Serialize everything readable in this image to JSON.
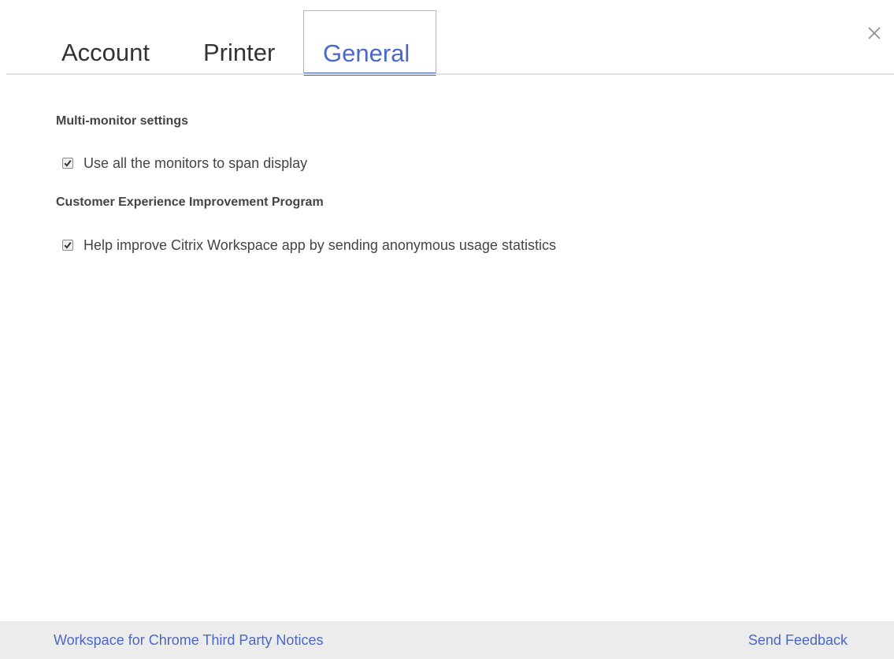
{
  "tabs": {
    "account": "Account",
    "printer": "Printer",
    "general": "General",
    "active": "General"
  },
  "close": {
    "icon": "close-icon"
  },
  "sections": {
    "multi_monitor": {
      "title": "Multi-monitor settings",
      "option_label": "Use all the monitors to span display",
      "checked": true
    },
    "ceip": {
      "title": "Customer Experience Improvement Program",
      "option_label": "Help improve Citrix Workspace app by sending anonymous usage statistics",
      "checked": true
    }
  },
  "footer": {
    "notices_link": "Workspace for Chrome Third Party Notices",
    "feedback_link": "Send Feedback"
  },
  "colors": {
    "accent": "#4a68c7",
    "focus_outline": "#e8b94a",
    "footer_bg": "#ececec"
  }
}
